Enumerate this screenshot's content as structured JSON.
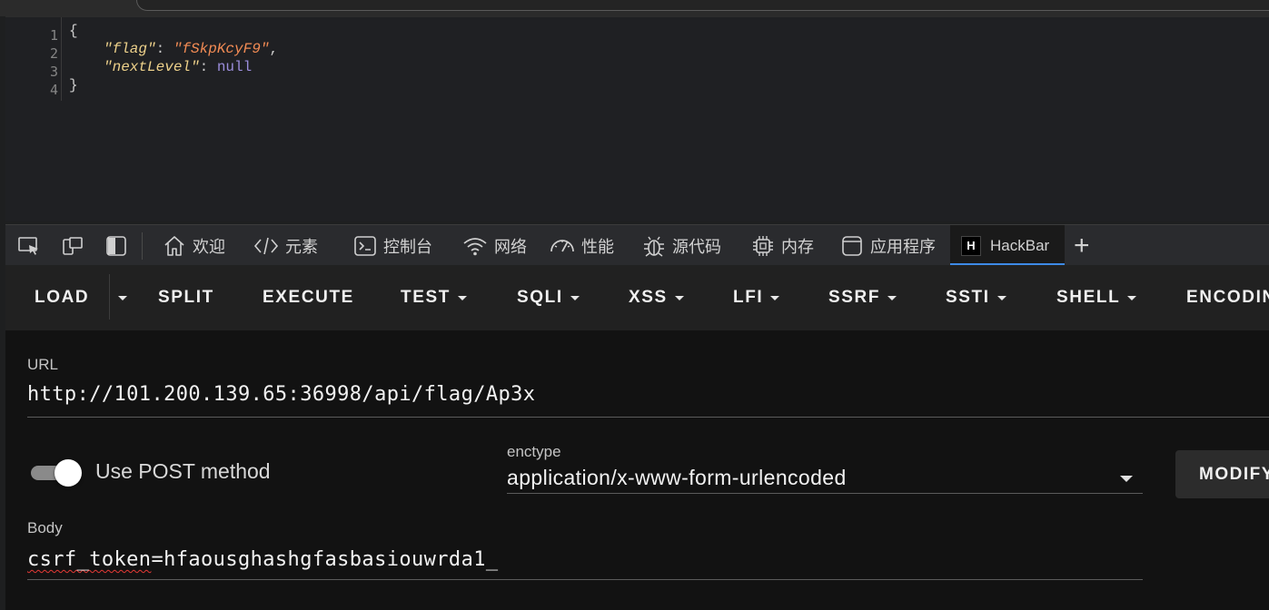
{
  "code_viewer": {
    "line_numbers": [
      "1",
      "2",
      "3",
      "4"
    ],
    "open_brace": "{",
    "close_brace": "}",
    "flag_key": "\"flag\"",
    "flag_value": "\"fSkpKcyF9\"",
    "next_key": "\"nextLevel\"",
    "next_value": "null",
    "colon": ": ",
    "comma": ","
  },
  "devtools_tabs": [
    {
      "label": "欢迎",
      "icon": "home-icon"
    },
    {
      "label": "元素",
      "icon": "code-icon"
    },
    {
      "label": "控制台",
      "icon": "console-icon"
    },
    {
      "label": "网络",
      "icon": "wifi-icon"
    },
    {
      "label": "性能",
      "icon": "gauge-icon"
    },
    {
      "label": "源代码",
      "icon": "bug-icon"
    },
    {
      "label": "内存",
      "icon": "chip-icon"
    },
    {
      "label": "应用程序",
      "icon": "window-icon"
    },
    {
      "label": "HackBar",
      "icon": "hackbar-logo",
      "logo_text": "H",
      "active": true
    }
  ],
  "add_tab_symbol": "+",
  "menu": {
    "load": "LOAD",
    "split": "SPLIT",
    "execute": "EXECUTE",
    "test": "TEST",
    "sqli": "SQLI",
    "xss": "XSS",
    "lfi": "LFI",
    "ssrf": "SSRF",
    "ssti": "SSTI",
    "shell": "SHELL",
    "encoding": "ENCODING"
  },
  "url_field": {
    "label": "URL",
    "value": "http://101.200.139.65:36998/api/flag/Ap3x"
  },
  "post_toggle": {
    "label": "Use POST method",
    "on": true
  },
  "enctype": {
    "label": "enctype",
    "value": "application/x-www-form-urlencoded"
  },
  "modify_button": {
    "label": "MODIFY"
  },
  "body_field": {
    "label": "Body",
    "value_underlined": "csrf_token",
    "value_rest": "=hfaousghashgfasbasiouwrda1_"
  },
  "colors": {
    "accent": "#3d8ae6",
    "panel_bg": "#121212",
    "menu_bg": "#212121",
    "json_string": "#f28b54",
    "json_key": "#ecd08a",
    "json_null": "#9b8ddb"
  }
}
